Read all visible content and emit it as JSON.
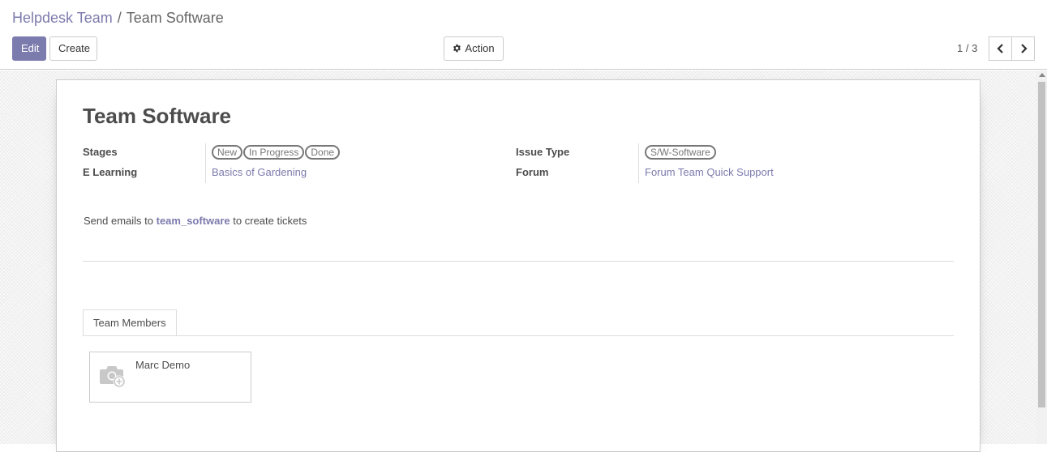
{
  "breadcrumb": {
    "parent": "Helpdesk Team",
    "separator": "/",
    "current": "Team Software"
  },
  "toolbar": {
    "edit_label": "Edit",
    "create_label": "Create",
    "action_label": "Action"
  },
  "pager": {
    "value": "1 / 3"
  },
  "record": {
    "title": "Team Software",
    "stages_label": "Stages",
    "stages": [
      "New",
      "In Progress",
      "Done"
    ],
    "elearning_label": "E Learning",
    "elearning_value": "Basics of Gardening",
    "issue_type_label": "Issue Type",
    "issue_types": [
      "S/W-Software"
    ],
    "forum_label": "Forum",
    "forum_value": "Forum Team Quick Support",
    "email_prefix": "Send emails to",
    "email_alias": "team_software",
    "email_suffix": "to create tickets"
  },
  "tabs": {
    "members_label": "Team Members"
  },
  "members": [
    {
      "name": "Marc Demo"
    }
  ],
  "colors": {
    "primary": "#7c7bad",
    "text": "#4c4c4c",
    "border": "#cccccc"
  },
  "icons": [
    "gear-icon",
    "chevron-left-icon",
    "chevron-right-icon",
    "camera-add-icon"
  ]
}
